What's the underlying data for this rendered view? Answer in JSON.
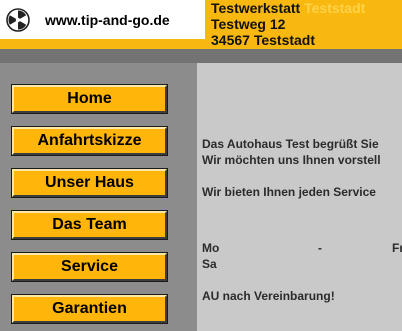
{
  "header": {
    "logo_icon": "circular-triskelion-logo",
    "url": "www.tip-and-go.de",
    "address": {
      "name_prefix": "Testwerkstatt",
      "name_city": "Teststadt",
      "street": "Testweg 12",
      "zip_city": "34567 Teststadt"
    }
  },
  "nav": {
    "items": [
      {
        "label": "Home"
      },
      {
        "label": "Anfahrtskizze"
      },
      {
        "label": "Unser Haus"
      },
      {
        "label": "Das Team"
      },
      {
        "label": "Service"
      },
      {
        "label": "Garantien"
      }
    ]
  },
  "content": {
    "welcome_line1": "Das Autohaus Test begrüßt Sie",
    "welcome_line2": "Wir möchten uns Ihnen vorstell",
    "service_line": "Wir bieten Ihnen jeden Service",
    "hours_mo": "Mo",
    "hours_dash": "-",
    "hours_fr": "Fr",
    "hours_sa": "Sa",
    "au_line": "AU nach Vereinbarung!"
  },
  "colors": {
    "accent": "#f9b80f",
    "button": "#ffb50a",
    "sidebar": "#8c8c8c",
    "content_bg": "#c9c9c9"
  }
}
